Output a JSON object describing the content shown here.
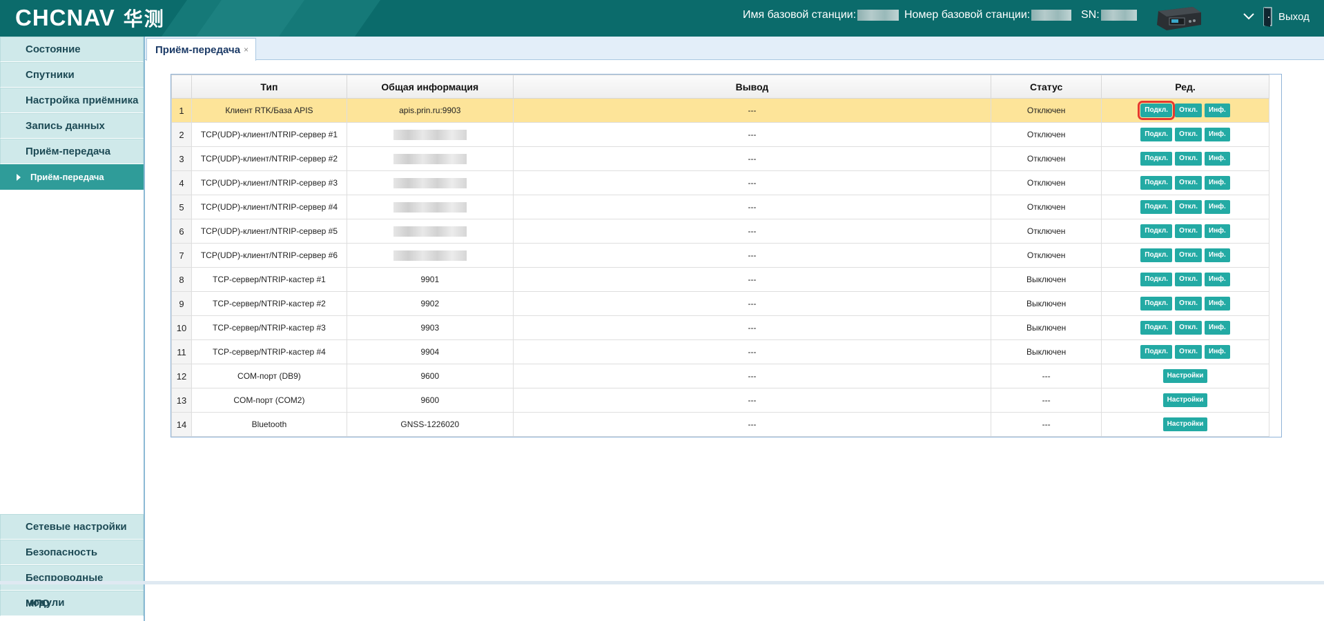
{
  "header": {
    "logo_text": "CHCNAV",
    "logo_cn": "华测",
    "base_station_name_label": "Имя базовой станции:",
    "base_station_number_label": "Номер базовой станции:",
    "sn_label": "SN:",
    "exit_label": "Выход",
    "colors": {
      "background": "#0b6b6b"
    }
  },
  "sidebar": {
    "items_top": [
      {
        "label": "Состояние"
      },
      {
        "label": "Спутники"
      },
      {
        "label": "Настройка приёмника"
      },
      {
        "label": "Запись данных"
      },
      {
        "label": "Приём-передача"
      }
    ],
    "active_sub": {
      "label": "Приём-передача"
    },
    "items_bottom": [
      {
        "label": "Сетевые настройки"
      },
      {
        "label": "Безопасность"
      },
      {
        "label": "Беспроводные модули"
      },
      {
        "label": "МПО"
      }
    ]
  },
  "tab": {
    "label": "Приём-передача",
    "close": "×"
  },
  "table": {
    "headers": [
      "",
      "Тип",
      "Общая информация",
      "Вывод",
      "Статус",
      "Ред."
    ],
    "buttons": {
      "connect": "Подкл.",
      "disconnect": "Откл.",
      "info": "Инф.",
      "settings": "Настройки"
    },
    "rows": [
      {
        "num": "1",
        "type": "Клиент RTK/База APIS",
        "info": "apis.prin.ru:9903",
        "output": "---",
        "status": "Отключен",
        "actions": "full",
        "selected": true
      },
      {
        "num": "2",
        "type": "TCP(UDP)-клиент/NTRIP-сервер #1",
        "info": "",
        "output": "---",
        "status": "Отключен",
        "actions": "full"
      },
      {
        "num": "3",
        "type": "TCP(UDP)-клиент/NTRIP-сервер #2",
        "info": "",
        "output": "---",
        "status": "Отключен",
        "actions": "full"
      },
      {
        "num": "4",
        "type": "TCP(UDP)-клиент/NTRIP-сервер #3",
        "info": "",
        "output": "---",
        "status": "Отключен",
        "actions": "full"
      },
      {
        "num": "5",
        "type": "TCP(UDP)-клиент/NTRIP-сервер #4",
        "info": "",
        "output": "---",
        "status": "Отключен",
        "actions": "full"
      },
      {
        "num": "6",
        "type": "TCP(UDP)-клиент/NTRIP-сервер #5",
        "info": "",
        "output": "---",
        "status": "Отключен",
        "actions": "full"
      },
      {
        "num": "7",
        "type": "TCP(UDP)-клиент/NTRIP-сервер #6",
        "info": "",
        "output": "---",
        "status": "Отключен",
        "actions": "full"
      },
      {
        "num": "8",
        "type": "TCP-сервер/NTRIP-кастер #1",
        "info": "9901",
        "output": "---",
        "status": "Выключен",
        "actions": "full"
      },
      {
        "num": "9",
        "type": "TCP-сервер/NTRIP-кастер #2",
        "info": "9902",
        "output": "---",
        "status": "Выключен",
        "actions": "full"
      },
      {
        "num": "10",
        "type": "TCP-сервер/NTRIP-кастер #3",
        "info": "9903",
        "output": "---",
        "status": "Выключен",
        "actions": "full"
      },
      {
        "num": "11",
        "type": "TCP-сервер/NTRIP-кастер #4",
        "info": "9904",
        "output": "---",
        "status": "Выключен",
        "actions": "full"
      },
      {
        "num": "12",
        "type": "COM-порт (DB9)",
        "info": "9600",
        "output": "---",
        "status": "---",
        "actions": "settings"
      },
      {
        "num": "13",
        "type": "COM-порт (COM2)",
        "info": "9600",
        "output": "---",
        "status": "---",
        "actions": "settings"
      },
      {
        "num": "14",
        "type": "Bluetooth",
        "info": "GNSS-1226020",
        "output": "---",
        "status": "---",
        "actions": "settings"
      }
    ]
  }
}
